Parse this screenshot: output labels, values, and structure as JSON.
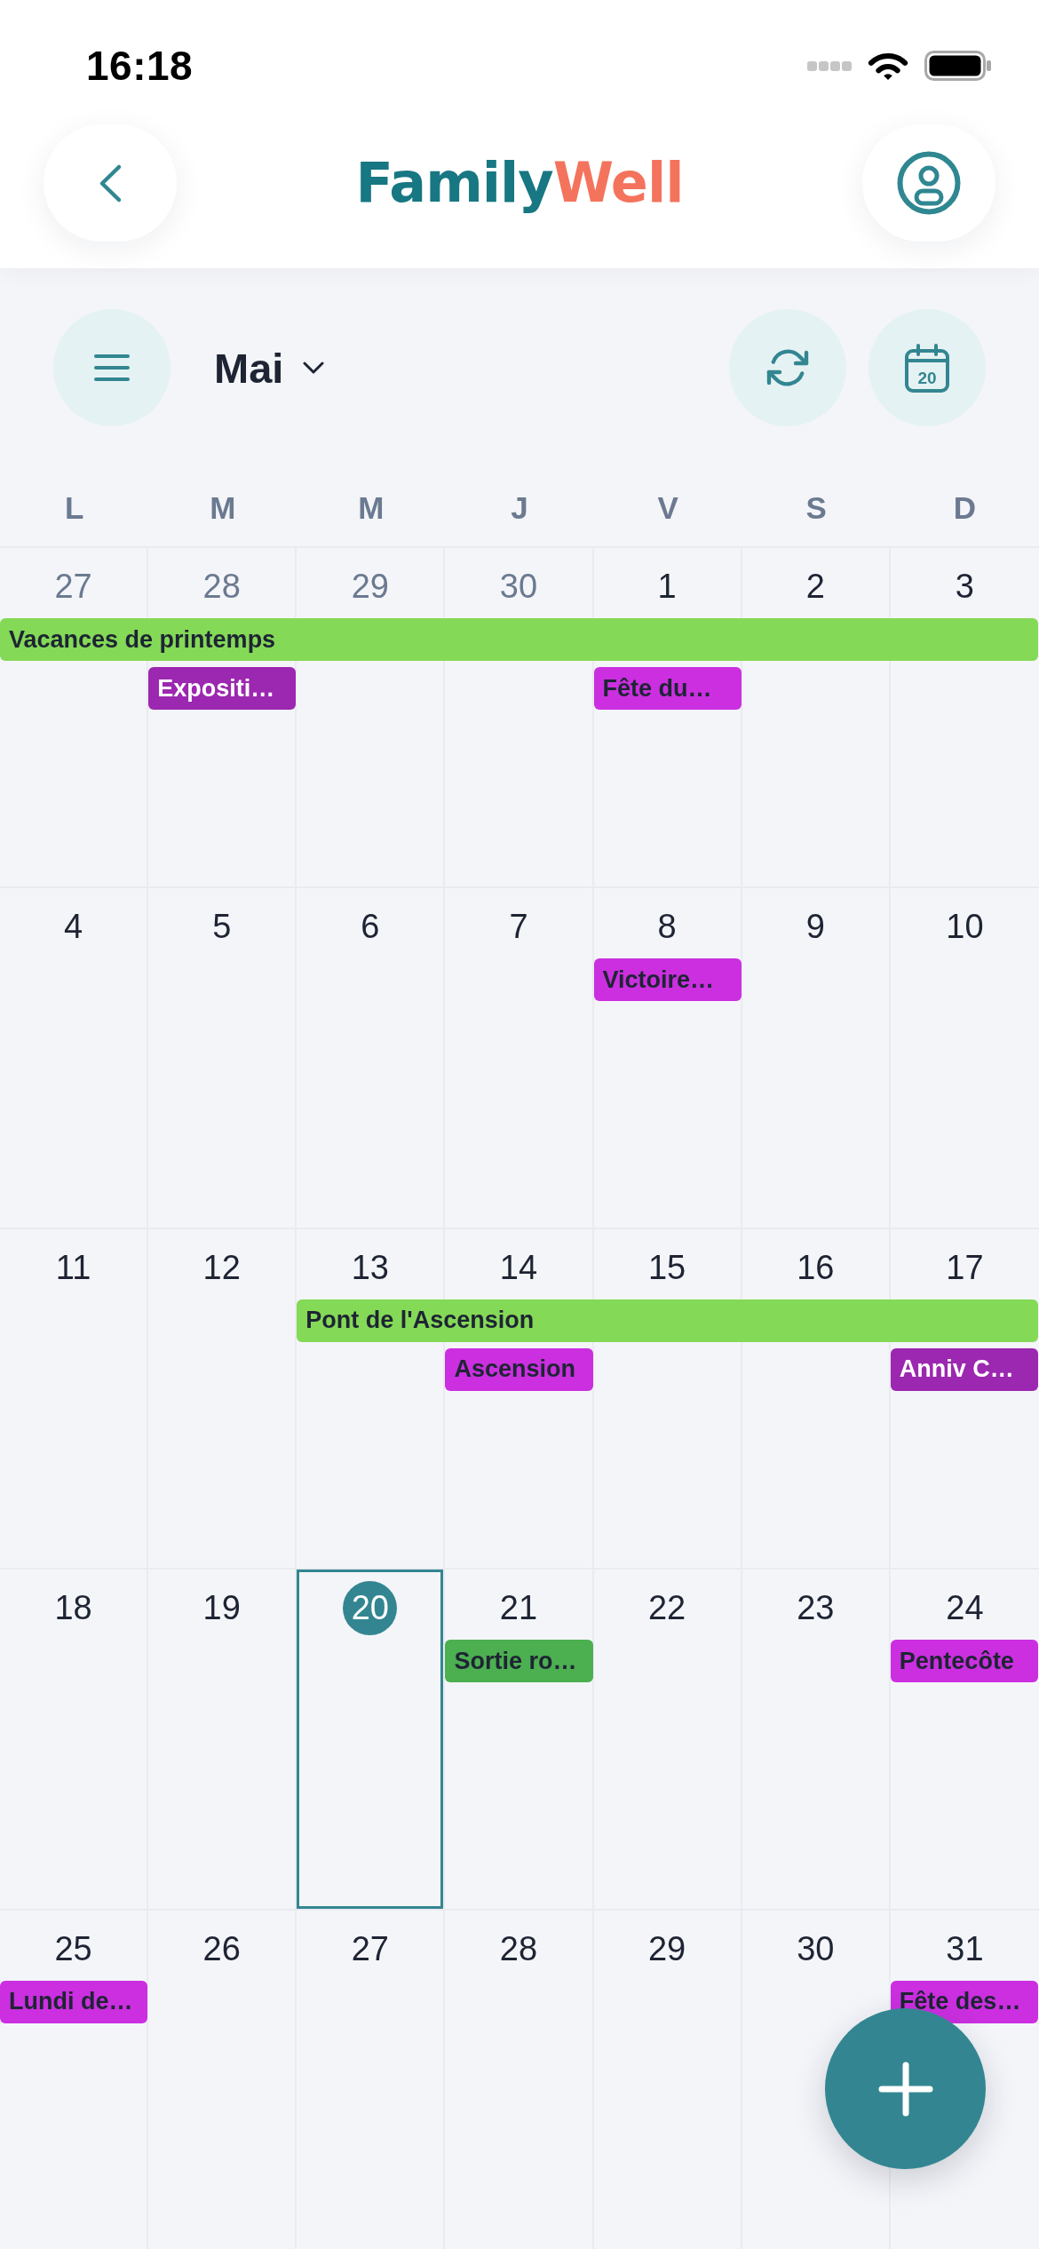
{
  "status_bar": {
    "time": "16:18"
  },
  "header": {
    "logo": {
      "first": "Family",
      "second": "Well"
    }
  },
  "toolbar": {
    "month": "Mai",
    "today_icon_day": "20"
  },
  "weekdays": [
    "L",
    "M",
    "M",
    "J",
    "V",
    "S",
    "D"
  ],
  "weeks": [
    {
      "days": [
        {
          "label": "27",
          "outside_month": true,
          "today": false
        },
        {
          "label": "28",
          "outside_month": true,
          "today": false
        },
        {
          "label": "29",
          "outside_month": true,
          "today": false
        },
        {
          "label": "30",
          "outside_month": true,
          "today": false
        },
        {
          "label": "1",
          "outside_month": false,
          "today": false
        },
        {
          "label": "2",
          "outside_month": false,
          "today": false
        },
        {
          "label": "3",
          "outside_month": false,
          "today": false
        }
      ],
      "lanes": [
        [
          {
            "kind": "event",
            "title": "Vacances de printemps",
            "color": "#84d957"
          },
          {
            "kind": "continued"
          },
          {
            "kind": "continued"
          },
          {
            "kind": "continued"
          },
          {
            "kind": "continued"
          },
          {
            "kind": "continued"
          },
          {
            "kind": "continued"
          }
        ],
        [
          {
            "kind": "empty"
          },
          {
            "kind": "event",
            "title": "Expositi…",
            "color": "#9c27b0"
          },
          {
            "kind": "empty"
          },
          {
            "kind": "empty"
          },
          {
            "kind": "event",
            "title": "Fête du…",
            "color": "#cb2fe0"
          },
          {
            "kind": "empty"
          },
          {
            "kind": "empty"
          }
        ]
      ]
    },
    {
      "days": [
        {
          "label": "4",
          "outside_month": false,
          "today": false
        },
        {
          "label": "5",
          "outside_month": false,
          "today": false
        },
        {
          "label": "6",
          "outside_month": false,
          "today": false
        },
        {
          "label": "7",
          "outside_month": false,
          "today": false
        },
        {
          "label": "8",
          "outside_month": false,
          "today": false
        },
        {
          "label": "9",
          "outside_month": false,
          "today": false
        },
        {
          "label": "10",
          "outside_month": false,
          "today": false
        }
      ],
      "lanes": [
        [
          {
            "kind": "empty"
          },
          {
            "kind": "empty"
          },
          {
            "kind": "empty"
          },
          {
            "kind": "empty"
          },
          {
            "kind": "event",
            "title": "Victoire…",
            "color": "#cb2fe0"
          },
          {
            "kind": "empty"
          },
          {
            "kind": "empty"
          }
        ]
      ]
    },
    {
      "days": [
        {
          "label": "11",
          "outside_month": false,
          "today": false
        },
        {
          "label": "12",
          "outside_month": false,
          "today": false
        },
        {
          "label": "13",
          "outside_month": false,
          "today": false
        },
        {
          "label": "14",
          "outside_month": false,
          "today": false
        },
        {
          "label": "15",
          "outside_month": false,
          "today": false
        },
        {
          "label": "16",
          "outside_month": false,
          "today": false
        },
        {
          "label": "17",
          "outside_month": false,
          "today": false
        }
      ],
      "lanes": [
        [
          {
            "kind": "empty"
          },
          {
            "kind": "empty"
          },
          {
            "kind": "event",
            "title": "Pont de l'Ascension",
            "color": "#84d957"
          },
          {
            "kind": "continued"
          },
          {
            "kind": "continued"
          },
          {
            "kind": "continued"
          },
          {
            "kind": "continued"
          }
        ],
        [
          {
            "kind": "empty"
          },
          {
            "kind": "empty"
          },
          {
            "kind": "empty"
          },
          {
            "kind": "event",
            "title": "Ascension",
            "color": "#cb2fe0"
          },
          {
            "kind": "empty"
          },
          {
            "kind": "empty"
          },
          {
            "kind": "event",
            "title": "Anniv C…",
            "color": "#9c27b0"
          }
        ]
      ]
    },
    {
      "days": [
        {
          "label": "18",
          "outside_month": false,
          "today": false
        },
        {
          "label": "19",
          "outside_month": false,
          "today": false
        },
        {
          "label": "20",
          "outside_month": false,
          "today": true
        },
        {
          "label": "21",
          "outside_month": false,
          "today": false
        },
        {
          "label": "22",
          "outside_month": false,
          "today": false
        },
        {
          "label": "23",
          "outside_month": false,
          "today": false
        },
        {
          "label": "24",
          "outside_month": false,
          "today": false
        }
      ],
      "lanes": [
        [
          {
            "kind": "empty"
          },
          {
            "kind": "empty"
          },
          {
            "kind": "empty"
          },
          {
            "kind": "event",
            "title": "Sortie ro…",
            "color": "#4caf50"
          },
          {
            "kind": "empty"
          },
          {
            "kind": "empty"
          },
          {
            "kind": "event",
            "title": "Pentecôte",
            "color": "#cb2fe0"
          }
        ]
      ]
    },
    {
      "days": [
        {
          "label": "25",
          "outside_month": false,
          "today": false
        },
        {
          "label": "26",
          "outside_month": false,
          "today": false
        },
        {
          "label": "27",
          "outside_month": false,
          "today": false
        },
        {
          "label": "28",
          "outside_month": false,
          "today": false
        },
        {
          "label": "29",
          "outside_month": false,
          "today": false
        },
        {
          "label": "30",
          "outside_month": false,
          "today": false
        },
        {
          "label": "31",
          "outside_month": false,
          "today": false
        }
      ],
      "lanes": [
        [
          {
            "kind": "event",
            "title": "Lundi de…",
            "color": "#cb2fe0"
          },
          {
            "kind": "empty"
          },
          {
            "kind": "empty"
          },
          {
            "kind": "empty"
          },
          {
            "kind": "empty"
          },
          {
            "kind": "empty"
          },
          {
            "kind": "event",
            "title": "Fête des…",
            "color": "#cb2fe0"
          }
        ]
      ]
    }
  ]
}
